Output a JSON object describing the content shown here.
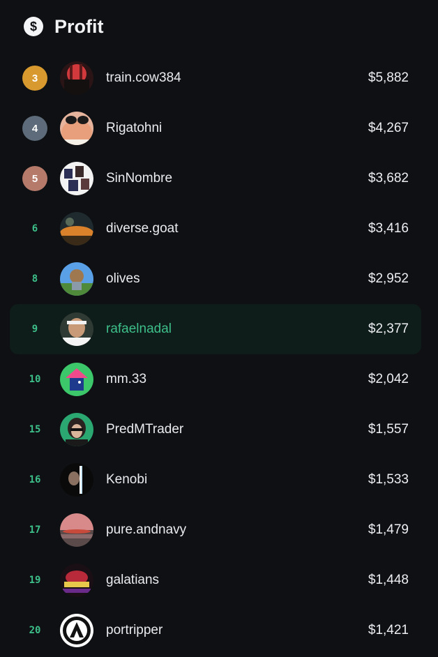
{
  "header": {
    "title": "Profit",
    "icon": "dollar-icon"
  },
  "rows": [
    {
      "rank": "3",
      "name": "train.cow384",
      "amount": "$5,882",
      "badge": "#d89a2e"
    },
    {
      "rank": "4",
      "name": "Rigatohni",
      "amount": "$4,267",
      "badge": "#5e6b7a"
    },
    {
      "rank": "5",
      "name": "SinNombre",
      "amount": "$3,682",
      "badge": "#b57a6a"
    },
    {
      "rank": "6",
      "name": "diverse.goat",
      "amount": "$3,416"
    },
    {
      "rank": "8",
      "name": "olives",
      "amount": "$2,952"
    },
    {
      "rank": "9",
      "name": "rafaelnadal",
      "amount": "$2,377",
      "highlight": true
    },
    {
      "rank": "10",
      "name": "mm.33",
      "amount": "$2,042"
    },
    {
      "rank": "15",
      "name": "PredMTrader",
      "amount": "$1,557"
    },
    {
      "rank": "16",
      "name": "Kenobi",
      "amount": "$1,533"
    },
    {
      "rank": "17",
      "name": "pure.andnavy",
      "amount": "$1,479"
    },
    {
      "rank": "19",
      "name": "galatians",
      "amount": "$1,448"
    },
    {
      "rank": "20",
      "name": "portripper",
      "amount": "$1,421"
    }
  ],
  "colors": {
    "accent": "#3dbf8a",
    "highlight_bg": "#0f1d1a",
    "background": "#0e1013"
  }
}
